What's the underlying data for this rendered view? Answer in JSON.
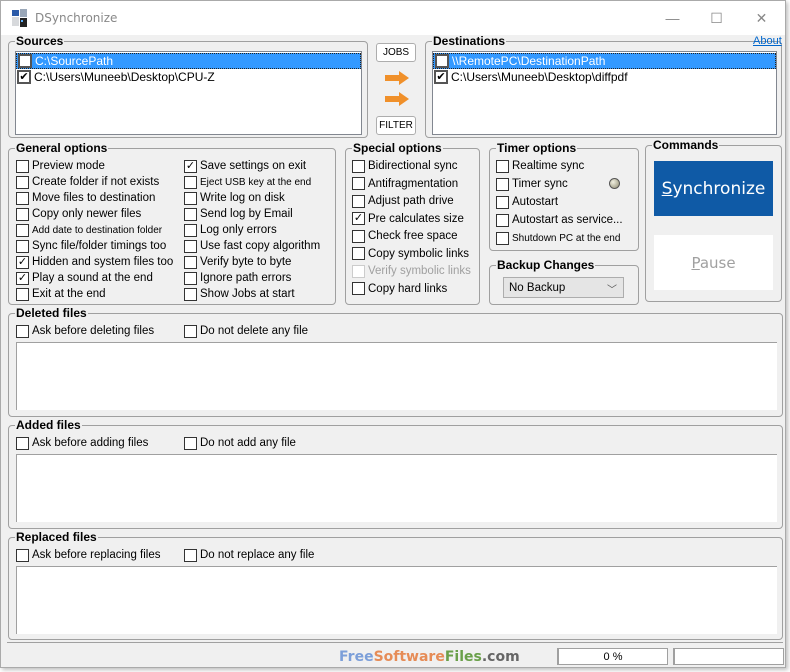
{
  "window": {
    "title": "DSynchronize",
    "controls": {
      "minimize": "—",
      "maximize": "☐",
      "close": "✕"
    },
    "icon": "app-icon"
  },
  "sources": {
    "legend": "Sources",
    "items": [
      {
        "path": "C:\\SourcePath",
        "checked": false,
        "selected": true
      },
      {
        "path": "C:\\Users\\Muneeb\\Desktop\\CPU-Z",
        "checked": true,
        "selected": false
      }
    ]
  },
  "middle": {
    "jobs_label": "JOBS",
    "filter_label": "FILTER",
    "arrow_icon": "arrow-right-icon"
  },
  "destinations": {
    "legend": "Destinations",
    "about_label": "About",
    "items": [
      {
        "path": "\\\\RemotePC\\DestinationPath",
        "checked": false,
        "selected": true
      },
      {
        "path": "C:\\Users\\Muneeb\\Desktop\\diffpdf",
        "checked": true,
        "selected": false
      }
    ]
  },
  "general_options": {
    "legend": "General options",
    "left": [
      {
        "label": "Preview mode",
        "checked": false
      },
      {
        "label": "Create folder if not exists",
        "checked": false
      },
      {
        "label": "Move files to destination",
        "checked": false
      },
      {
        "label": "Copy only newer files",
        "checked": false
      },
      {
        "label": "Add date to destination folder",
        "checked": false
      },
      {
        "label": "Sync file/folder timings too",
        "checked": false
      },
      {
        "label": "Hidden and system files too",
        "checked": true
      },
      {
        "label": "Play a sound at the end",
        "checked": true
      },
      {
        "label": "Exit at the end",
        "checked": false
      }
    ],
    "right": [
      {
        "label": "Save settings on exit",
        "checked": true
      },
      {
        "label": "Eject USB key at the end",
        "checked": false
      },
      {
        "label": "Write log on disk",
        "checked": false
      },
      {
        "label": "Send log by Email",
        "checked": false
      },
      {
        "label": "Log only errors",
        "checked": false
      },
      {
        "label": "Use fast copy algorithm",
        "checked": false
      },
      {
        "label": "Verify byte to byte",
        "checked": false
      },
      {
        "label": "Ignore path errors",
        "checked": false
      },
      {
        "label": "Show Jobs at start",
        "checked": false
      }
    ]
  },
  "special_options": {
    "legend": "Special options",
    "items": [
      {
        "label": "Bidirectional sync",
        "checked": false,
        "disabled": false
      },
      {
        "label": "Antifragmentation",
        "checked": false,
        "disabled": false
      },
      {
        "label": "Adjust path drive",
        "checked": false,
        "disabled": false
      },
      {
        "label": "Pre calculates size",
        "checked": true,
        "disabled": false
      },
      {
        "label": "Check free space",
        "checked": false,
        "disabled": false
      },
      {
        "label": "Copy symbolic links",
        "checked": false,
        "disabled": false
      },
      {
        "label": "Verify symbolic links",
        "checked": false,
        "disabled": true
      },
      {
        "label": "Copy hard links",
        "checked": false,
        "disabled": false
      }
    ]
  },
  "timer_options": {
    "legend": "Timer options",
    "items": [
      {
        "label": "Realtime sync",
        "checked": false
      },
      {
        "label": "Timer sync",
        "checked": false
      },
      {
        "label": "Autostart",
        "checked": false
      },
      {
        "label": "Autostart as service...",
        "checked": false
      },
      {
        "label": "Shutdown PC at the end",
        "checked": false
      }
    ],
    "timer_icon": "timer-knob-icon"
  },
  "backup_changes": {
    "legend": "Backup Changes",
    "selected": "No Backup"
  },
  "commands": {
    "legend": "Commands",
    "synchronize_label": "Synchronize",
    "pause_label": "Pause",
    "accent": "#0f5aa6"
  },
  "deleted_files": {
    "legend": "Deleted files",
    "ask_label": "Ask before deleting files",
    "ask_checked": false,
    "none_label": "Do not delete any file",
    "none_checked": false
  },
  "added_files": {
    "legend": "Added files",
    "ask_label": "Ask before adding files",
    "ask_checked": false,
    "none_label": "Do not add any file",
    "none_checked": false
  },
  "replaced_files": {
    "legend": "Replaced files",
    "ask_label": "Ask before replacing files",
    "ask_checked": false,
    "none_label": "Do not replace any file",
    "none_checked": false
  },
  "status_bar": {
    "watermark": {
      "free": "Free",
      "software": "Software",
      "files": "Files",
      "com": ".com"
    },
    "progress_text": "0 %",
    "progress_percent": 0,
    "extra_text": ""
  }
}
